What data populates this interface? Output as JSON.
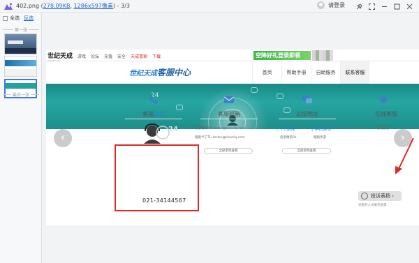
{
  "viewer": {
    "filename": "402.png",
    "filesize": "278.09KB",
    "dimensions": "1286x597像素",
    "counter": "3/3",
    "separator": " - ",
    "login_label": "请登录",
    "controls": [
      "pin-icon",
      "fullscreen-icon",
      "minimize-icon",
      "restore-icon",
      "close-icon"
    ]
  },
  "sidebar": {
    "select_all": "全选",
    "invert": "反选",
    "first_label": "第一张",
    "last_label": "最后一张"
  },
  "webpage": {
    "logo": "世纪天成",
    "logo_sub": "tiancity.com",
    "nav": [
      "游戏",
      "论坛",
      "充值",
      "安全",
      "天成管家",
      "下载"
    ],
    "banner": "空降好礼登录即领",
    "cs_logo_main": "世纪天成",
    "cs_logo_sub": "客服中心",
    "cs_logo_en": "SERVICE CENTER",
    "cs_nav": [
      "首页",
      "帮助手册",
      "自助服务",
      "联系客服"
    ],
    "cs_nav_active": "联系客服",
    "hero_text": "24",
    "arrow_left": "‹",
    "arrow_right": "›",
    "panels": {
      "phone": {
        "title_prefix": "客服",
        "title_highlight": "电话",
        "number": "021-34144567",
        "badge": "24"
      },
      "email": {
        "title": "客服邮箱",
        "line1": "反恐精英OL: xxxxx@tiancity.com",
        "line2": "跑跑卡丁车: kartxx@tiancity.com",
        "more": "全部游戏查看"
      },
      "forum": {
        "title": "论坛地址",
        "pc": "PC游戏",
        "mobile": "手机游戏",
        "item1": "反恐精英OL",
        "item2": "跑跑手游",
        "more": "全部游戏查看"
      },
      "online": {
        "title": "在线客服",
        "link": "在线客服",
        "complaint": "投诉表扬",
        "note": "对服务人员服务质量"
      }
    }
  }
}
